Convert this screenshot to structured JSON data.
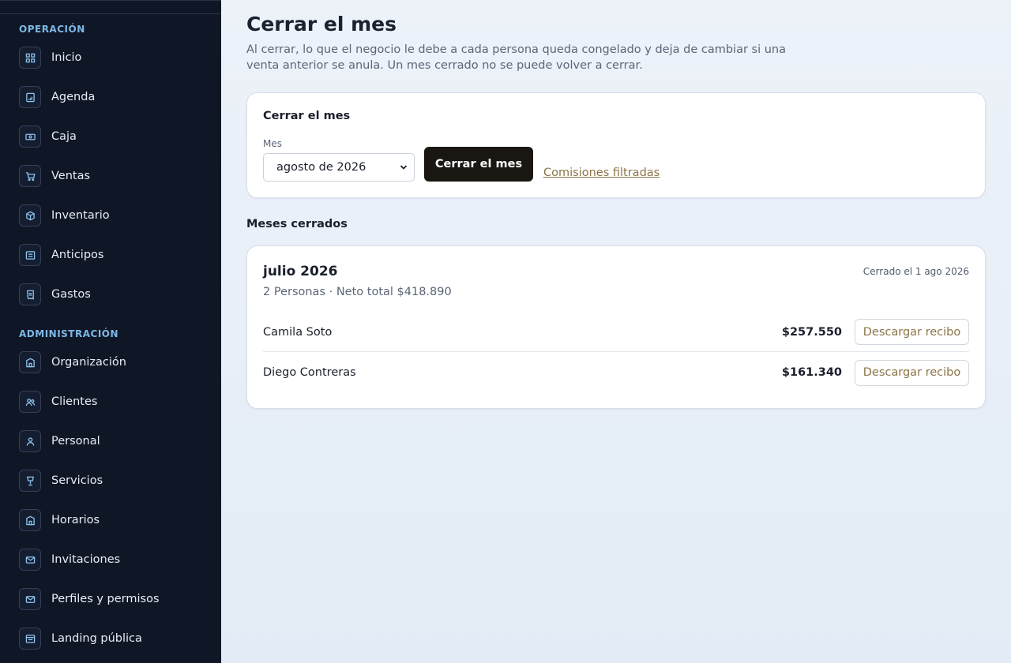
{
  "sidebar": {
    "sections": [
      {
        "title": "OPERACIÓN",
        "items": [
          {
            "label": "Inicio",
            "icon": "grid-icon"
          },
          {
            "label": "Agenda",
            "icon": "calendar-icon"
          },
          {
            "label": "Caja",
            "icon": "cash-icon"
          },
          {
            "label": "Ventas",
            "icon": "cart-icon"
          },
          {
            "label": "Inventario",
            "icon": "box-icon"
          },
          {
            "label": "Anticipos",
            "icon": "wallet-icon"
          },
          {
            "label": "Gastos",
            "icon": "receipt-icon"
          }
        ]
      },
      {
        "title": "ADMINISTRACIÓN",
        "items": [
          {
            "label": "Organización",
            "icon": "building-icon"
          },
          {
            "label": "Clientes",
            "icon": "users-icon"
          },
          {
            "label": "Personal",
            "icon": "user-icon"
          },
          {
            "label": "Servicios",
            "icon": "glass-icon"
          },
          {
            "label": "Horarios",
            "icon": "building-icon"
          },
          {
            "label": "Invitaciones",
            "icon": "mail-icon"
          },
          {
            "label": "Perfiles y permisos",
            "icon": "mail-icon"
          },
          {
            "label": "Landing pública",
            "icon": "browser-icon"
          }
        ]
      }
    ]
  },
  "header": {
    "title": "Cerrar el mes",
    "description": "Al cerrar, lo que el negocio le debe a cada persona queda congelado y deja de cambiar si una venta anterior se anula. Un mes cerrado no se puede volver a cerrar."
  },
  "close_card": {
    "title": "Cerrar el mes",
    "field_label": "Mes",
    "selected_month": "agosto de 2026",
    "button_label": "Cerrar el mes",
    "link_label": "Comisiones filtradas"
  },
  "closed_months": {
    "heading": "Meses cerrados",
    "months": [
      {
        "title": "julio 2026",
        "closed_date": "Cerrado el 1 ago 2026",
        "summary": "2 Personas · Neto total $418.890",
        "rows": [
          {
            "name": "Camila Soto",
            "amount": "$257.550",
            "action": "Descargar recibo"
          },
          {
            "name": "Diego Contreras",
            "amount": "$161.340",
            "action": "Descargar recibo"
          }
        ]
      }
    ]
  },
  "colors": {
    "sidebar_bg": "#0f1726",
    "section_title": "#7eb8e6",
    "primary_button": "#1a1712",
    "link": "#8c7447"
  }
}
